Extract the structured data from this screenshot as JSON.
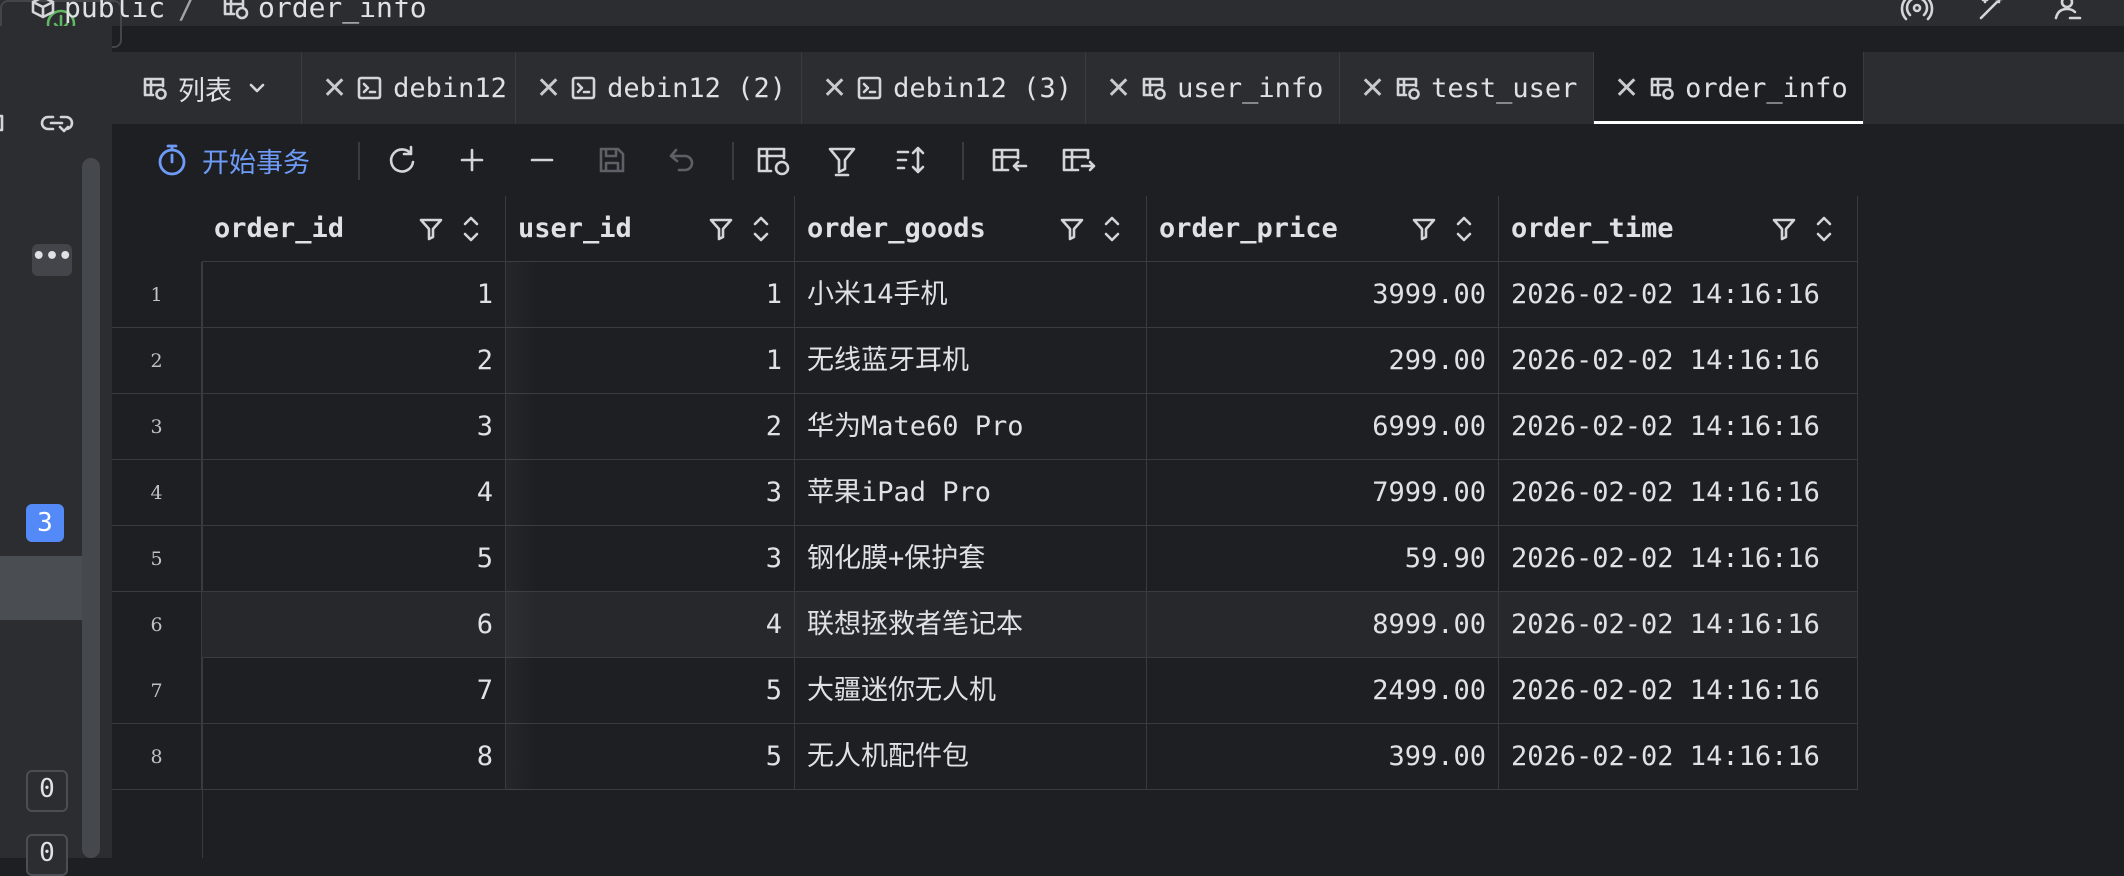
{
  "breadcrumb": {
    "schema": "public",
    "separator": "/",
    "table": "order_info"
  },
  "sidebar": {
    "more_label": "•••",
    "badges": [
      "3",
      "0",
      "0"
    ]
  },
  "tabs": [
    {
      "label": "列表",
      "kind": "list",
      "closable": false
    },
    {
      "label": "debin12",
      "kind": "console",
      "closable": true
    },
    {
      "label": "debin12 (2)",
      "kind": "console",
      "closable": true
    },
    {
      "label": "debin12 (3)",
      "kind": "console",
      "closable": true
    },
    {
      "label": "user_info",
      "kind": "table",
      "closable": true
    },
    {
      "label": "test_user",
      "kind": "table",
      "closable": true
    },
    {
      "label": "order_info",
      "kind": "table",
      "closable": true,
      "active": true
    }
  ],
  "toolbar": {
    "transaction_label": "开始事务",
    "accent": "#6d9bf7"
  },
  "grid": {
    "columns": [
      "order_id",
      "user_id",
      "order_goods",
      "order_price",
      "order_time"
    ],
    "rows": [
      {
        "n": "1",
        "order_id": "1",
        "user_id": "1",
        "order_goods": "小米14手机",
        "order_price": "3999.00",
        "order_time": "2026-02-02 14:16:16"
      },
      {
        "n": "2",
        "order_id": "2",
        "user_id": "1",
        "order_goods": "无线蓝牙耳机",
        "order_price": "299.00",
        "order_time": "2026-02-02 14:16:16"
      },
      {
        "n": "3",
        "order_id": "3",
        "user_id": "2",
        "order_goods": "华为Mate60 Pro",
        "order_price": "6999.00",
        "order_time": "2026-02-02 14:16:16"
      },
      {
        "n": "4",
        "order_id": "4",
        "user_id": "3",
        "order_goods": "苹果iPad Pro",
        "order_price": "7999.00",
        "order_time": "2026-02-02 14:16:16"
      },
      {
        "n": "5",
        "order_id": "5",
        "user_id": "3",
        "order_goods": "钢化膜+保护套",
        "order_price": "59.90",
        "order_time": "2026-02-02 14:16:16"
      },
      {
        "n": "6",
        "order_id": "6",
        "user_id": "4",
        "order_goods": "联想拯救者笔记本",
        "order_price": "8999.00",
        "order_time": "2026-02-02 14:16:16"
      },
      {
        "n": "7",
        "order_id": "7",
        "user_id": "5",
        "order_goods": "大疆迷你无人机",
        "order_price": "2499.00",
        "order_time": "2026-02-02 14:16:16"
      },
      {
        "n": "8",
        "order_id": "8",
        "user_id": "5",
        "order_goods": "无人机配件包",
        "order_price": "399.00",
        "order_time": "2026-02-02 14:16:16"
      }
    ]
  }
}
